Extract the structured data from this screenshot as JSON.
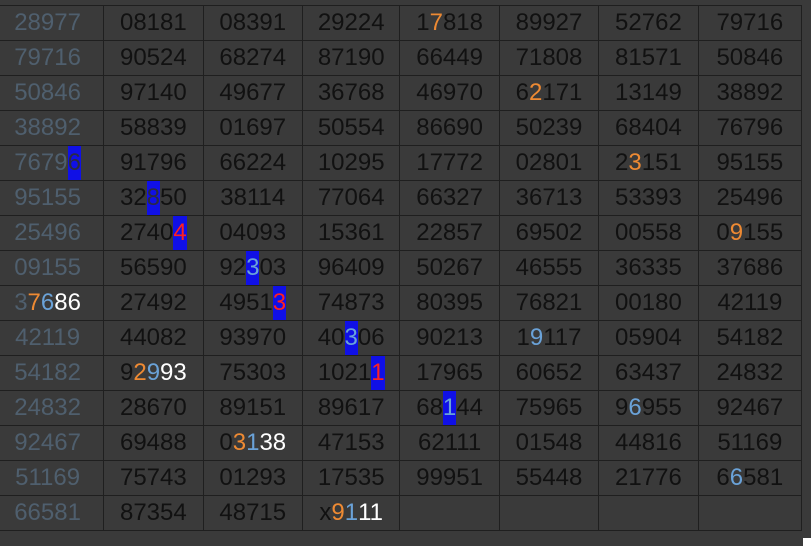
{
  "grid": {
    "rows": [
      [
        {
          "text": "28977"
        },
        {
          "text": "08181"
        },
        {
          "text": "08391"
        },
        {
          "text": "29224"
        },
        {
          "parts": [
            [
              "1",
              ""
            ],
            [
              "7",
              "orange"
            ],
            [
              "818",
              ""
            ]
          ]
        },
        {
          "text": "89927"
        },
        {
          "text": "52762"
        },
        {
          "text": "79716"
        }
      ],
      [
        {
          "text": "79716"
        },
        {
          "text": "90524"
        },
        {
          "text": "68274"
        },
        {
          "text": "87190"
        },
        {
          "text": "66449"
        },
        {
          "text": "71808"
        },
        {
          "text": "81571"
        },
        {
          "text": "50846"
        }
      ],
      [
        {
          "text": "50846"
        },
        {
          "text": "97140"
        },
        {
          "text": "49677"
        },
        {
          "text": "36768"
        },
        {
          "text": "46970"
        },
        {
          "parts": [
            [
              "6",
              ""
            ],
            [
              "2",
              "orange"
            ],
            [
              "171",
              ""
            ]
          ]
        },
        {
          "text": "13149"
        },
        {
          "text": "38892"
        }
      ],
      [
        {
          "text": "38892"
        },
        {
          "text": "58839"
        },
        {
          "text": "01697"
        },
        {
          "text": "50554"
        },
        {
          "text": "86690"
        },
        {
          "text": "50239"
        },
        {
          "text": "68404"
        },
        {
          "text": "76796"
        }
      ],
      [
        {
          "parts": [
            [
              "7679",
              ""
            ],
            [
              "6",
              "hl-blue"
            ]
          ]
        },
        {
          "text": "91796"
        },
        {
          "text": "66224"
        },
        {
          "text": "10295"
        },
        {
          "text": "17772"
        },
        {
          "text": "02801"
        },
        {
          "parts": [
            [
              "2",
              ""
            ],
            [
              "3",
              "orange"
            ],
            [
              "151",
              ""
            ]
          ]
        },
        {
          "text": "95155"
        }
      ],
      [
        {
          "text": "95155"
        },
        {
          "parts": [
            [
              "32",
              ""
            ],
            [
              "8",
              "hl-blue"
            ],
            [
              "50",
              ""
            ]
          ]
        },
        {
          "text": "38114"
        },
        {
          "text": "77064"
        },
        {
          "text": "66327"
        },
        {
          "text": "36713"
        },
        {
          "text": "53393"
        },
        {
          "text": "25496"
        }
      ],
      [
        {
          "text": "25496"
        },
        {
          "parts": [
            [
              "2740",
              ""
            ],
            [
              "4",
              "hl-blue-red"
            ]
          ]
        },
        {
          "text": "04093"
        },
        {
          "text": "15361"
        },
        {
          "text": "22857"
        },
        {
          "text": "69502"
        },
        {
          "text": "00558"
        },
        {
          "parts": [
            [
              "0",
              ""
            ],
            [
              "9",
              "orange"
            ],
            [
              "155",
              ""
            ]
          ]
        }
      ],
      [
        {
          "text": "09155"
        },
        {
          "text": "56590"
        },
        {
          "parts": [
            [
              "92",
              ""
            ],
            [
              "3",
              "hl-blue-light"
            ],
            [
              "03",
              ""
            ]
          ]
        },
        {
          "text": "96409"
        },
        {
          "text": "50267"
        },
        {
          "text": "46555"
        },
        {
          "text": "36335"
        },
        {
          "text": "37686"
        }
      ],
      [
        {
          "parts": [
            [
              "3",
              ""
            ],
            [
              "7",
              "orange"
            ],
            [
              "6",
              "lightblue"
            ],
            [
              "86",
              "white"
            ]
          ]
        },
        {
          "text": "27492"
        },
        {
          "parts": [
            [
              "4951",
              ""
            ],
            [
              "3",
              "hl-blue-red"
            ]
          ]
        },
        {
          "text": "74873"
        },
        {
          "text": "80395"
        },
        {
          "text": "76821"
        },
        {
          "text": "00180"
        },
        {
          "text": "42119"
        }
      ],
      [
        {
          "text": "42119"
        },
        {
          "text": "44082"
        },
        {
          "text": "93970"
        },
        {
          "parts": [
            [
              "40",
              ""
            ],
            [
              "3",
              "hl-blue-light"
            ],
            [
              "06",
              ""
            ]
          ]
        },
        {
          "text": "90213"
        },
        {
          "parts": [
            [
              "1",
              ""
            ],
            [
              "9",
              "lightblue"
            ],
            [
              "117",
              ""
            ]
          ]
        },
        {
          "text": "05904"
        },
        {
          "text": "54182"
        }
      ],
      [
        {
          "text": "54182"
        },
        {
          "parts": [
            [
              "9",
              ""
            ],
            [
              "2",
              "orange"
            ],
            [
              "9",
              "lightblue"
            ],
            [
              "93",
              "white"
            ]
          ]
        },
        {
          "text": "75303"
        },
        {
          "parts": [
            [
              "1021",
              ""
            ],
            [
              "1",
              "hl-blue-red"
            ]
          ]
        },
        {
          "text": "17965"
        },
        {
          "text": "60652"
        },
        {
          "text": "63437"
        },
        {
          "text": "24832"
        }
      ],
      [
        {
          "text": "24832"
        },
        {
          "text": "28670"
        },
        {
          "text": "89151"
        },
        {
          "text": "89617"
        },
        {
          "parts": [
            [
              "68",
              ""
            ],
            [
              "1",
              "hl-blue-light"
            ],
            [
              "44",
              ""
            ]
          ]
        },
        {
          "text": "75965"
        },
        {
          "parts": [
            [
              "9",
              ""
            ],
            [
              "6",
              "lightblue"
            ],
            [
              "955",
              ""
            ]
          ]
        },
        {
          "text": "92467"
        }
      ],
      [
        {
          "text": "92467"
        },
        {
          "text": "69488"
        },
        {
          "parts": [
            [
              "0",
              ""
            ],
            [
              "3",
              "orange"
            ],
            [
              "1",
              "lightblue"
            ],
            [
              "38",
              "white"
            ]
          ]
        },
        {
          "text": "47153"
        },
        {
          "text": "62111"
        },
        {
          "text": "01548"
        },
        {
          "text": "44816"
        },
        {
          "text": "51169"
        }
      ],
      [
        {
          "text": "51169"
        },
        {
          "text": "75743"
        },
        {
          "text": "01293"
        },
        {
          "text": "17535"
        },
        {
          "text": "99951"
        },
        {
          "text": "55448"
        },
        {
          "text": "21776"
        },
        {
          "parts": [
            [
              "6",
              ""
            ],
            [
              "6",
              "lightblue"
            ],
            [
              "581",
              ""
            ]
          ]
        }
      ],
      [
        {
          "text": "66581"
        },
        {
          "text": "87354"
        },
        {
          "text": "48715"
        },
        {
          "parts": [
            [
              "x",
              ""
            ],
            [
              "9",
              "orange"
            ],
            [
              "1",
              "lightblue"
            ],
            [
              "11",
              "white"
            ]
          ]
        },
        {
          "text": ""
        },
        {
          "text": ""
        },
        {
          "text": ""
        },
        {
          "text": ""
        }
      ]
    ]
  },
  "colors": {
    "background": "#3a3a3a",
    "first_column_text": "#4f5f6e",
    "cell_text": "#111111",
    "orange": "#ee8a33",
    "light_blue": "#6aa2d8",
    "white": "#ffffff",
    "red": "#ff2020",
    "highlight_blue": "#1010e6"
  }
}
